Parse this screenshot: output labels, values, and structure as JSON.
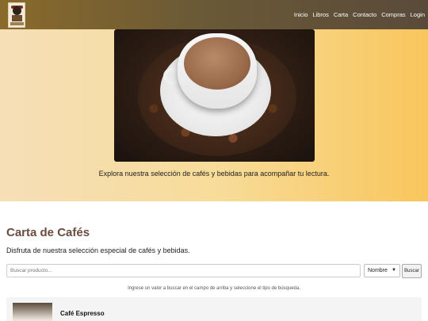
{
  "nav": {
    "items": [
      {
        "label": "Inicio"
      },
      {
        "label": "Libros"
      },
      {
        "label": "Carta"
      },
      {
        "label": "Contacto"
      },
      {
        "label": "Compras"
      },
      {
        "label": "Login"
      }
    ]
  },
  "hero": {
    "caption": "Explora nuestra selección de cafés y bebidas para acompañar tu lectura."
  },
  "carta": {
    "title": "Carta de Cafés",
    "subtitle": "Disfruta de nuestra selección especial de cafés y bebidas.",
    "search_placeholder": "Buscar producto...",
    "search_type": "Nombre",
    "search_button": "Buscar",
    "search_hint": "Ingrese un valor a buscar en el campo de arriba y seleccione el tipo de búsqueda."
  },
  "products": [
    {
      "name": "Café Espresso"
    }
  ],
  "icons": {
    "select_chevron": "chevron-down-icon"
  },
  "colors": {
    "nav_bg": "#6b5a36",
    "title_color": "#6b4b3e",
    "hero_left": "#f6dfb8",
    "hero_right": "#f9c65c"
  }
}
